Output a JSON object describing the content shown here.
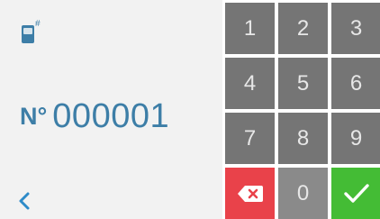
{
  "display": {
    "device_icon_superscript": "#",
    "number_prefix": "N°",
    "number_value": "000001"
  },
  "keypad": {
    "digits": [
      "1",
      "2",
      "3",
      "4",
      "5",
      "6",
      "7",
      "8",
      "9"
    ],
    "zero": "0"
  },
  "icons": {
    "back": "chevron-left-icon",
    "delete": "backspace-icon",
    "confirm": "checkmark-icon",
    "device": "device-icon"
  },
  "colors": {
    "accent": "#3d7ea7",
    "key": "#757575",
    "delete": "#e9424a",
    "confirm": "#44bc35",
    "panel": "#f2f2f2"
  }
}
